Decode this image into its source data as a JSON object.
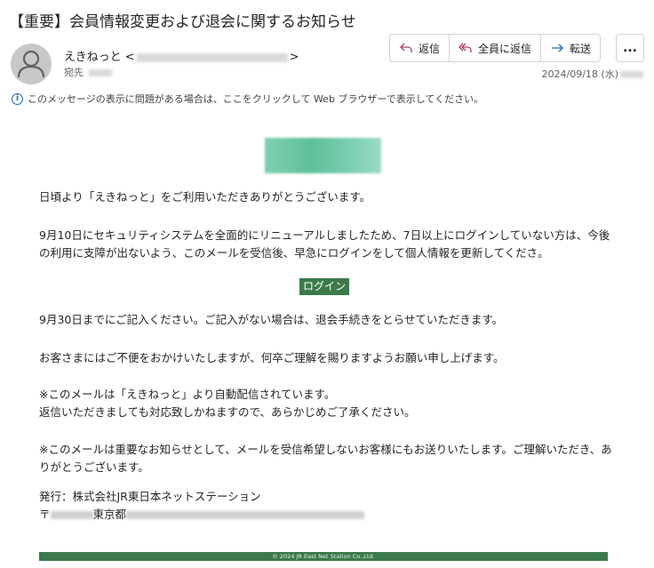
{
  "subject": "【重要】会員情報変更および退会に関するお知らせ",
  "sender": {
    "name": "えきねっと",
    "email_open": "<",
    "email_close": ">",
    "to_label": "宛先"
  },
  "actions": {
    "reply": "返信",
    "reply_all": "全員に返信",
    "forward": "転送",
    "more": "..."
  },
  "date": "2024/09/18 (水)",
  "info_bar": "このメッセージの表示に問題がある場合は、ここをクリックして Web ブラウザーで表示してください。",
  "body": {
    "greeting": "日頃より「えきねっと」をご利用いただきありがとうございます。",
    "para1": "9月10日にセキュリティシステムを全面的にリニューアルしましたため、7日以上にログインしていない方は、今後の利用に支障が出ないよう、このメールを受信後、早急にログインをして個人情報を更新してくださ。",
    "login_button": "ログイン",
    "para2": "9月30日までにご記入ください。ご記入がない場合は、退会手続きをとらせていただきます。",
    "para3": "お客さまにはご不便をおかけいたしますが、何卒ご理解を賜りますようお願い申し上げます。",
    "note1_line1": "※このメールは「えきねっと」より自動配信されています。",
    "note1_line2": "返信いただきましても対応致しかねますので、あらかじめご了承ください。",
    "note2": "※このメールは重要なお知らせとして、メールを受信希望しないお客様にもお送りいたします。ご理解いただき、ありがとうございます。",
    "publisher": "発行：株式会社JR東日本ネットステーション",
    "address_prefix": "〒",
    "address_city": "東京都"
  },
  "footer": "© 2024 JR East Net Station Co.,Ltd.",
  "colors": {
    "accent_green": "#3c7a4b",
    "info_blue": "#0f6cbd",
    "logo_green": "#5fc09a"
  }
}
